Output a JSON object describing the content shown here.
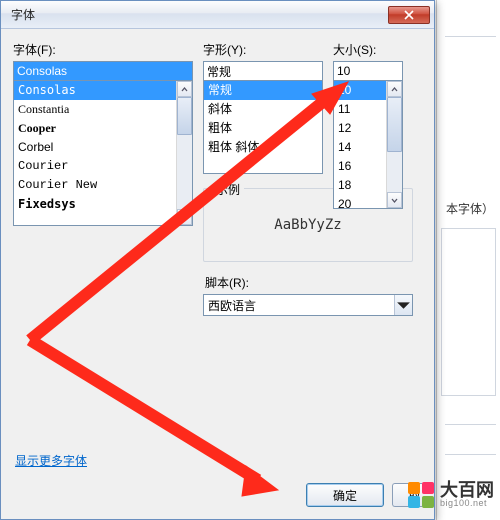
{
  "dialog": {
    "title": "字体",
    "font_label": "字体(F):",
    "style_label": "字形(Y):",
    "size_label": "大小(S):",
    "font_value": "Consolas",
    "style_value": "常规",
    "size_value": "10",
    "font_list": [
      {
        "label": "Consolas",
        "cls": "f-consolas",
        "selected": true
      },
      {
        "label": "Constantia",
        "cls": "f-constantia"
      },
      {
        "label": "Cooper",
        "cls": "f-cooper"
      },
      {
        "label": "Corbel",
        "cls": "f-corbel"
      },
      {
        "label": "Courier",
        "cls": "f-courier"
      },
      {
        "label": "Courier New",
        "cls": "f-couriernew"
      },
      {
        "label": "Fixedsys",
        "cls": "f-fixedsys"
      }
    ],
    "style_list": [
      {
        "label": "常规",
        "selected": true
      },
      {
        "label": "斜体"
      },
      {
        "label": "粗体"
      },
      {
        "label": "粗体 斜体"
      }
    ],
    "size_list": [
      {
        "label": "10",
        "selected": true
      },
      {
        "label": "11"
      },
      {
        "label": "12"
      },
      {
        "label": "14"
      },
      {
        "label": "16"
      },
      {
        "label": "18"
      },
      {
        "label": "20"
      }
    ],
    "sample_legend": "示例",
    "sample_text": "AaBbYyZz",
    "script_label": "脚本(R):",
    "script_value": "西欧语言",
    "more_fonts": "显示更多字体",
    "ok": "确定",
    "cancel_partial": "取"
  },
  "behind": {
    "text": "本字体）"
  },
  "watermark": {
    "name": "大百网",
    "domain": "big100.net",
    "colors": [
      "#ff8a00",
      "#ff3366",
      "#33b5e5",
      "#7cb342"
    ]
  }
}
